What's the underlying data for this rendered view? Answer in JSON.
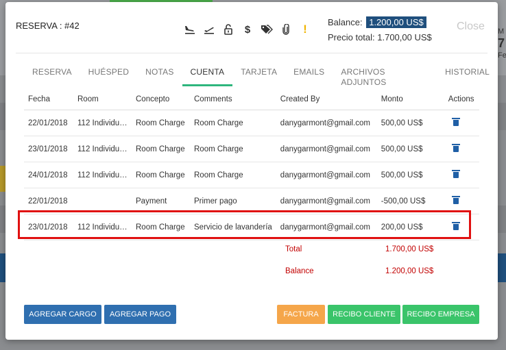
{
  "background": {
    "right_peek": [
      "M",
      "7",
      "Fe"
    ]
  },
  "header": {
    "title": "RESERVA : #42",
    "icons": [
      "plane-arrival-icon",
      "plane-departure-icon",
      "unlock-icon",
      "dollar-icon",
      "tags-icon",
      "paperclip-icon",
      "warning-icon"
    ],
    "balance_label": "Balance:",
    "balance_value": "1.200,00 US$",
    "total_price": "Precio total: 1.700,00 US$",
    "close_label": "Close"
  },
  "tabs": [
    {
      "label": "RESERVA"
    },
    {
      "label": "HUÉSPED"
    },
    {
      "label": "NOTAS"
    },
    {
      "label": "CUENTA",
      "active": true
    },
    {
      "label": "TARJETA"
    },
    {
      "label": "EMAILS"
    },
    {
      "label": "ARCHIVOS ADJUNTOS"
    },
    {
      "label": "HISTORIAL"
    }
  ],
  "table": {
    "headers": [
      "Fecha",
      "Room",
      "Concepto",
      "Comments",
      "Created By",
      "Monto",
      "Actions"
    ],
    "rows": [
      {
        "date": "22/01/2018",
        "room": "112 Individual...",
        "concept": "Room Charge",
        "comments": "Room Charge",
        "created_by": "danygarmont@gmail.com",
        "amount": "500,00 US$"
      },
      {
        "date": "23/01/2018",
        "room": "112 Individual...",
        "concept": "Room Charge",
        "comments": "Room Charge",
        "created_by": "danygarmont@gmail.com",
        "amount": "500,00 US$"
      },
      {
        "date": "24/01/2018",
        "room": "112 Individual...",
        "concept": "Room Charge",
        "comments": "Room Charge",
        "created_by": "danygarmont@gmail.com",
        "amount": "500,00 US$"
      },
      {
        "date": "22/01/2018",
        "room": "",
        "concept": "Payment",
        "comments": "Primer pago",
        "created_by": "danygarmont@gmail.com",
        "amount": "-500,00 US$"
      },
      {
        "date": "23/01/2018",
        "room": "112 Individual...",
        "concept": "Room Charge",
        "comments": "Servicio de lavandería",
        "created_by": "danygarmont@gmail.com",
        "amount": "200,00 US$"
      }
    ]
  },
  "summary": {
    "total_label": "Total",
    "total_value": "1.700,00 US$",
    "balance_label": "Balance",
    "balance_value": "1.200,00 US$"
  },
  "buttons": {
    "add_charge": "AGREGAR CARGO",
    "add_payment": "AGREGAR PAGO",
    "invoice": "FACTURA",
    "client_receipt": "RECIBO CLIENTE",
    "company_receipt": "RECIBO EMPRESA"
  },
  "colors": {
    "accent_green": "#2eb67d",
    "primary_blue": "#2f6fb0",
    "highlight_red": "#e01010",
    "warning": "#f0b400"
  }
}
